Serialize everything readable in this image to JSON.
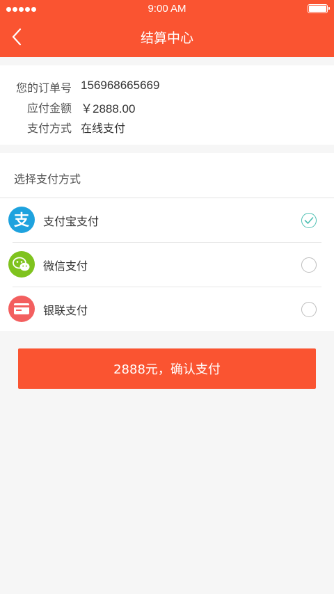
{
  "status_bar": {
    "time": "9:00 AM"
  },
  "header": {
    "title": "结算中心"
  },
  "order": {
    "rows": [
      {
        "label": "您的订单号",
        "value": "156968665669"
      },
      {
        "label": "应付金额",
        "value": "￥2888.00"
      },
      {
        "label": "支付方式",
        "value": "在线支付"
      }
    ]
  },
  "payment": {
    "section_title": "选择支付方式",
    "methods": [
      {
        "label": "支付宝支付",
        "icon": "alipay-icon",
        "color": "#1ea2de",
        "selected": true
      },
      {
        "label": "微信支付",
        "icon": "wechat-icon",
        "color": "#7fc31e",
        "selected": false
      },
      {
        "label": "银联支付",
        "icon": "unionpay-card-icon",
        "color": "#f35f5f",
        "selected": false
      }
    ]
  },
  "confirm_button": {
    "label": "2888元，确认支付"
  },
  "colors": {
    "accent": "#fa5431",
    "check": "#4cbfb2",
    "background": "#f6f6f6"
  }
}
